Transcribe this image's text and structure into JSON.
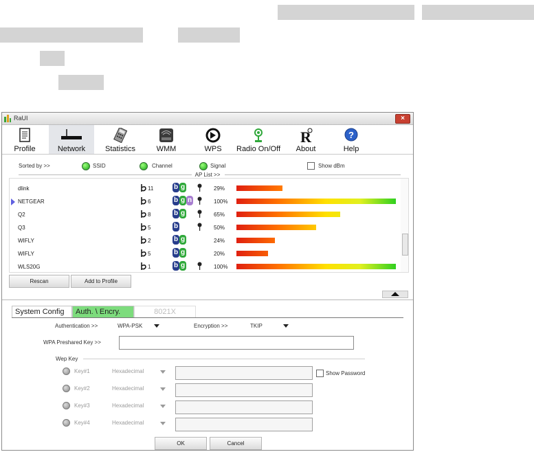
{
  "window": {
    "title": "RaUI",
    "close_glyph": "×"
  },
  "toolbar": [
    {
      "label": "Profile",
      "icon": "profile-icon"
    },
    {
      "label": "Network",
      "icon": "network-icon",
      "active": true
    },
    {
      "label": "Statistics",
      "icon": "statistics-icon"
    },
    {
      "label": "WMM",
      "icon": "wmm-icon"
    },
    {
      "label": "WPS",
      "icon": "wps-icon"
    },
    {
      "label": "Radio On/Off",
      "icon": "radio-icon"
    },
    {
      "label": "About",
      "icon": "about-icon"
    },
    {
      "label": "Help",
      "icon": "help-icon"
    }
  ],
  "sort": {
    "label": "Sorted by >>",
    "ssid": "SSID",
    "channel": "Channel",
    "signal": "Signal",
    "show_dbm": "Show dBm"
  },
  "ap_list": {
    "label": "AP List >>",
    "rows": [
      {
        "ssid": "dlink",
        "channel": "11",
        "modes": [
          "b",
          "g"
        ],
        "lock": true,
        "signal": "29%",
        "signal_value": 0.29
      },
      {
        "ssid": "NETGEAR",
        "channel": "6",
        "modes": [
          "b",
          "g",
          "n"
        ],
        "lock": true,
        "signal": "100%",
        "signal_value": 1.0,
        "selected": true
      },
      {
        "ssid": "Q2",
        "channel": "8",
        "modes": [
          "b",
          "g"
        ],
        "lock": true,
        "signal": "65%",
        "signal_value": 0.65
      },
      {
        "ssid": "Q3",
        "channel": "5",
        "modes": [
          "b"
        ],
        "lock": true,
        "signal": "50%",
        "signal_value": 0.5
      },
      {
        "ssid": "WIFLY",
        "channel": "2",
        "modes": [
          "b",
          "g"
        ],
        "lock": false,
        "signal": "24%",
        "signal_value": 0.24
      },
      {
        "ssid": "WIFLY",
        "channel": "5",
        "modes": [
          "b",
          "g"
        ],
        "lock": false,
        "signal": "20%",
        "signal_value": 0.2
      },
      {
        "ssid": "WLS20G",
        "channel": "1",
        "modes": [
          "b",
          "g"
        ],
        "lock": true,
        "signal": "100%",
        "signal_value": 1.0
      }
    ]
  },
  "buttons": {
    "rescan": "Rescan",
    "add_profile": "Add to Profile",
    "ok": "OK",
    "cancel": "Cancel"
  },
  "tabs": [
    {
      "label": "System Config"
    },
    {
      "label": "Auth. \\ Encry.",
      "active": true
    },
    {
      "label": "8021X",
      "disabled": true
    }
  ],
  "form": {
    "auth_label": "Authentication >>",
    "auth_value": "WPA-PSK",
    "enc_label": "Encryption >>",
    "enc_value": "TKIP",
    "wpa_label": "WPA Preshared Key >>",
    "wpa_value": "",
    "wep_label": "Wep Key",
    "show_password": "Show Password",
    "keys": [
      {
        "label": "Key#1",
        "format": "Hexadecimal"
      },
      {
        "label": "Key#2",
        "format": "Hexadecimal"
      },
      {
        "label": "Key#3",
        "format": "Hexadecimal"
      },
      {
        "label": "Key#4",
        "format": "Hexadecimal"
      }
    ]
  },
  "colors": {
    "active_tab": "#7ddc7d",
    "mode_b": "#273d8c",
    "mode_g": "#2fa83a",
    "mode_n": "#a77ed0"
  }
}
